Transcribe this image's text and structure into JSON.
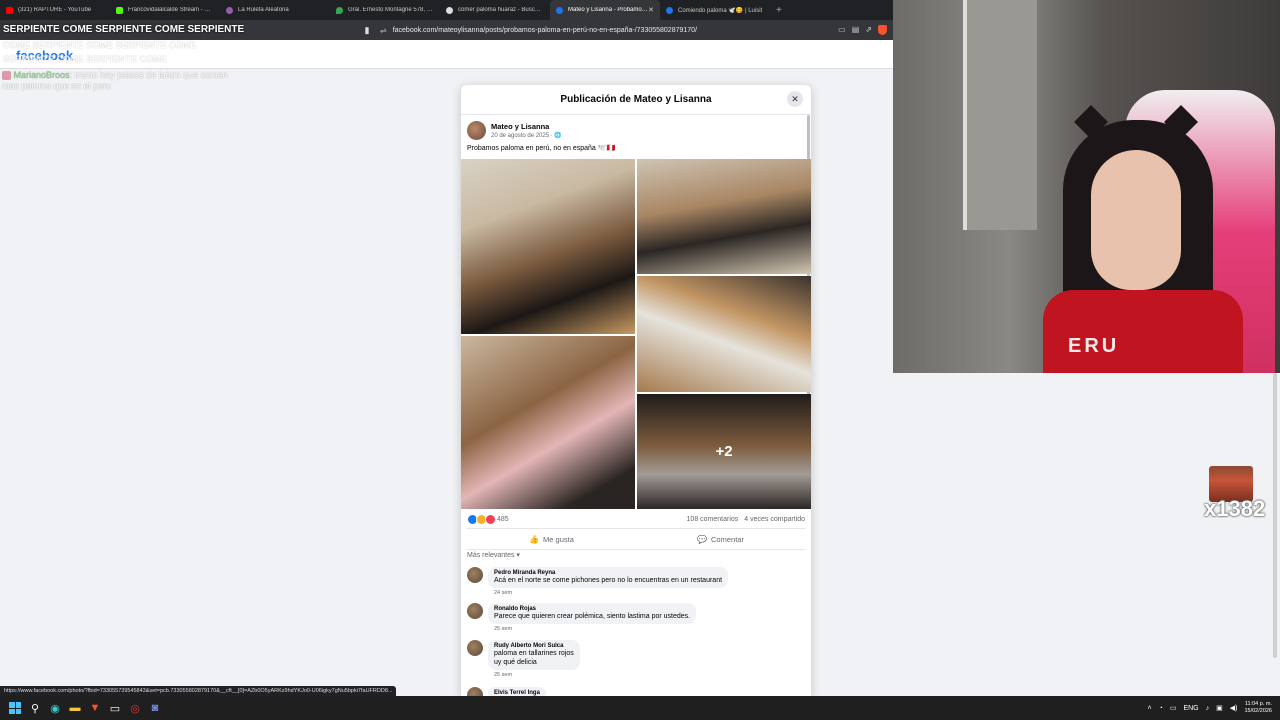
{
  "browser": {
    "tabs": [
      {
        "title": "(321) RAPTURE - YouTube",
        "color": "#ff0000",
        "active": false
      },
      {
        "title": "Francovidalalcalde Stream - Watch Li",
        "color": "#53fc18",
        "active": false
      },
      {
        "title": "La Ruleta Aleatoria",
        "color": "#9b59b6",
        "active": false
      },
      {
        "title": "Gral. Ernesto Montagne 578, Miraflo",
        "color": "#34a853",
        "active": false
      },
      {
        "title": "comer paloma huaraz - Buscar con G",
        "color": "#dddddd",
        "active": false
      },
      {
        "title": "Mateo y Lisanna - Probamos pa",
        "color": "#1877f2",
        "active": true,
        "close": "✕"
      },
      {
        "title": "Comiendo paloma 🕊️😋 | Luisit",
        "color": "#1877f2",
        "active": false
      }
    ],
    "new_tab": "+",
    "url": "facebook.com/mateoylisanna/posts/probamos-paloma-en-perú-no-en-españa-/733055802879170/",
    "status_url": "https://www.facebook.com/photo/?fbid=733055739545843&set=pcb.733055802879170&__cft__[0]=AZb0O5yARKz9hdYKJo0-U06igky7gNu5bpki7faUFRDD8..."
  },
  "overlay": {
    "serpiente_title": "SERPIENTE COME SERPIENTE COME SERPIENTE",
    "ghost_line1": "COME SERPIENTE COME SERPIENTE COME",
    "ghost_line2": "SERPIENTE COME SERPIENTE COME",
    "chat_user": "MarianoBroos",
    "chat_message": ": tremo hay palaos de latam que comen mas paloma que en el peru",
    "emote_counter": "x1382"
  },
  "facebook": {
    "logo": "facebook",
    "modal": {
      "title": "Publicación de Mateo y Lisanna",
      "close": "✕",
      "author": "Mateo y Lisanna",
      "date": "20 de agosto de 2025 · 🌐",
      "caption": "Probamos paloma en perú, no en españa 🕊️🇵🇪",
      "more_photos": "+2",
      "reaction_count": "485",
      "comments_count": "108 comentarios",
      "shares_count": "4 veces compartido",
      "like_label": "Me gusta",
      "comment_label": "Comentar",
      "sort_label": "Más relevantes ▾",
      "comments": [
        {
          "name": "Pedro Miranda Reyna",
          "text": "Acá en el norte se come pichones pero no lo encuentras en un restaurant",
          "time": "24 sem"
        },
        {
          "name": "Ronaldo Rojas",
          "text": "Parece que quieren crear polémica, siento lastima por ustedes.",
          "time": "25 sem"
        },
        {
          "name": "Rudy Alberto Mori Sulca",
          "text": "paloma en tallarines rojos\nuy qué delicia",
          "time": "25 sem"
        },
        {
          "name": "Elvis Terrel Inga",
          "text": "",
          "time": ""
        }
      ]
    }
  },
  "webcam": {
    "shirt_text": "ERU"
  },
  "taskbar": {
    "lang": "ENG",
    "time": "11:04 p. m.",
    "date": "15/02/2026"
  }
}
